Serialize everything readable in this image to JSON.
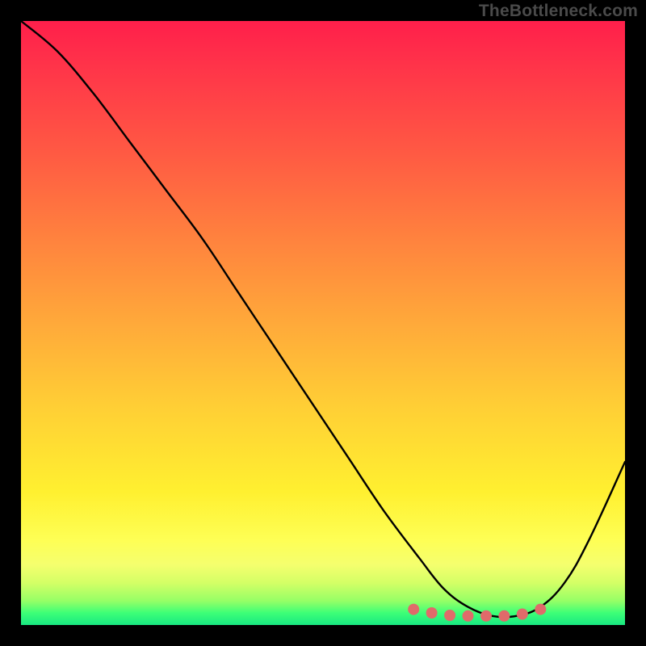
{
  "watermark": "TheBottleneck.com",
  "chart_data": {
    "type": "line",
    "title": "",
    "xlabel": "",
    "ylabel": "",
    "xlim": [
      0,
      100
    ],
    "ylim": [
      0,
      100
    ],
    "grid": false,
    "legend": false,
    "series": [
      {
        "name": "curve",
        "x": [
          0,
          6,
          12,
          18,
          24,
          30,
          36,
          42,
          48,
          54,
          60,
          66,
          70,
          74,
          78,
          82,
          86,
          90,
          94,
          100
        ],
        "values": [
          100,
          95,
          88,
          80,
          72,
          64,
          55,
          46,
          37,
          28,
          19,
          11,
          6,
          3,
          1.5,
          1.5,
          3,
          7,
          14,
          27
        ]
      }
    ],
    "markers": {
      "name": "highlight-dots",
      "x": [
        65,
        68,
        71,
        74,
        77,
        80,
        83,
        86
      ],
      "values": [
        2.6,
        2.0,
        1.6,
        1.5,
        1.5,
        1.5,
        1.8,
        2.6
      ],
      "color": "#e06a6a",
      "size": 7
    },
    "gradient_stops": [
      {
        "offset": 0,
        "color": "#ff1f4b"
      },
      {
        "offset": 22,
        "color": "#ff5a43"
      },
      {
        "offset": 50,
        "color": "#ffa93a"
      },
      {
        "offset": 78,
        "color": "#fff030"
      },
      {
        "offset": 93,
        "color": "#d4ff66"
      },
      {
        "offset": 100,
        "color": "#18e881"
      }
    ]
  }
}
